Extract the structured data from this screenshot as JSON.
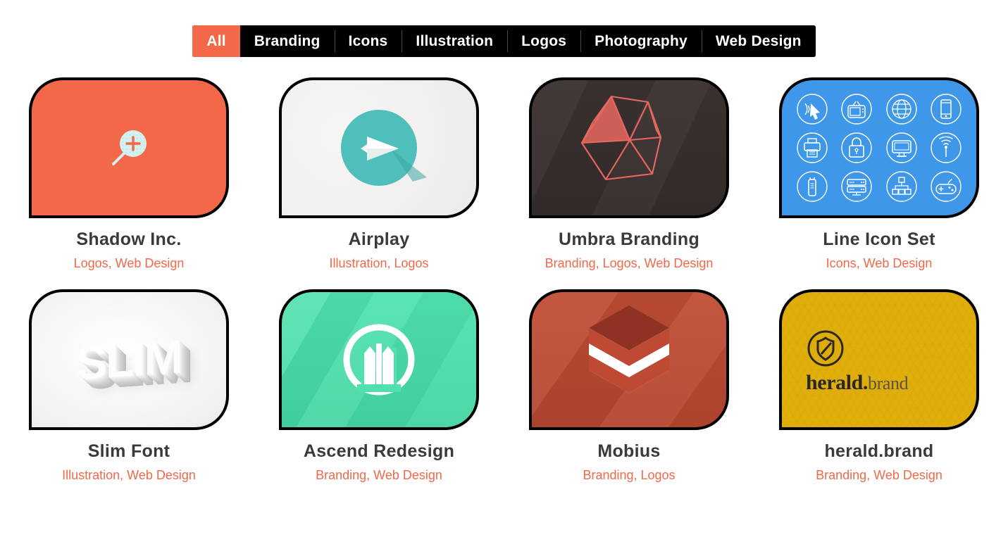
{
  "filter_bar": {
    "active": "All",
    "items": [
      {
        "label": "All",
        "active": true
      },
      {
        "label": "Branding",
        "active": false
      },
      {
        "label": "Icons",
        "active": false
      },
      {
        "label": "Illustration",
        "active": false
      },
      {
        "label": "Logos",
        "active": false
      },
      {
        "label": "Photography",
        "active": false
      },
      {
        "label": "Web Design",
        "active": false
      }
    ]
  },
  "colors": {
    "accent": "#F26849",
    "filter_bg": "#000000",
    "title": "#3a3a3a",
    "card_border": "#000000",
    "page_bg": "#ffffff"
  },
  "portfolio": {
    "items": [
      {
        "title": "Shadow Inc.",
        "categories": "Logos, Web Design",
        "thumb_bg": "#F26849",
        "thumb_art": "magnifier-plus-icon"
      },
      {
        "title": "Airplay",
        "categories": "Illustration, Logos",
        "thumb_bg": "#f2f1ef",
        "thumb_art": "paper-plane-in-teal-circle"
      },
      {
        "title": "Umbra Branding",
        "categories": "Branding, Logos, Web Design",
        "thumb_bg": "#3b3231",
        "thumb_art": "wireframe-icosahedron"
      },
      {
        "title": "Line Icon Set",
        "categories": "Icons, Web Design",
        "thumb_bg": "#3E97E8",
        "thumb_art": "twelve-line-icons-grid",
        "icons": [
          "cursor-click-icon",
          "tv-icon",
          "globe-icon",
          "smartphone-icon",
          "printer-icon",
          "lock-icon",
          "monitor-icon",
          "wifi-signal-icon",
          "usb-drive-icon",
          "server-icon",
          "sitemap-icon",
          "gamepad-icon"
        ]
      },
      {
        "title": "Slim Font",
        "categories": "Illustration, Web Design",
        "thumb_bg": "#fbfbfb",
        "thumb_art": "slim-3d-text",
        "art_text": "SLIM"
      },
      {
        "title": "Ascend Redesign",
        "categories": "Branding, Web Design",
        "thumb_bg": "#4FE0AC",
        "thumb_art": "ascend-circle-monogram"
      },
      {
        "title": "Mobius",
        "categories": "Branding, Logos",
        "thumb_bg": "#BF4A33",
        "thumb_art": "hexagon-chevron-logo"
      },
      {
        "title": "herald.brand",
        "categories": "Branding, Web Design",
        "thumb_bg": "#E0AE0B",
        "thumb_art": "shield-in-circle-logo",
        "art_text_bold": "herald.",
        "art_text_light": "brand"
      }
    ]
  }
}
